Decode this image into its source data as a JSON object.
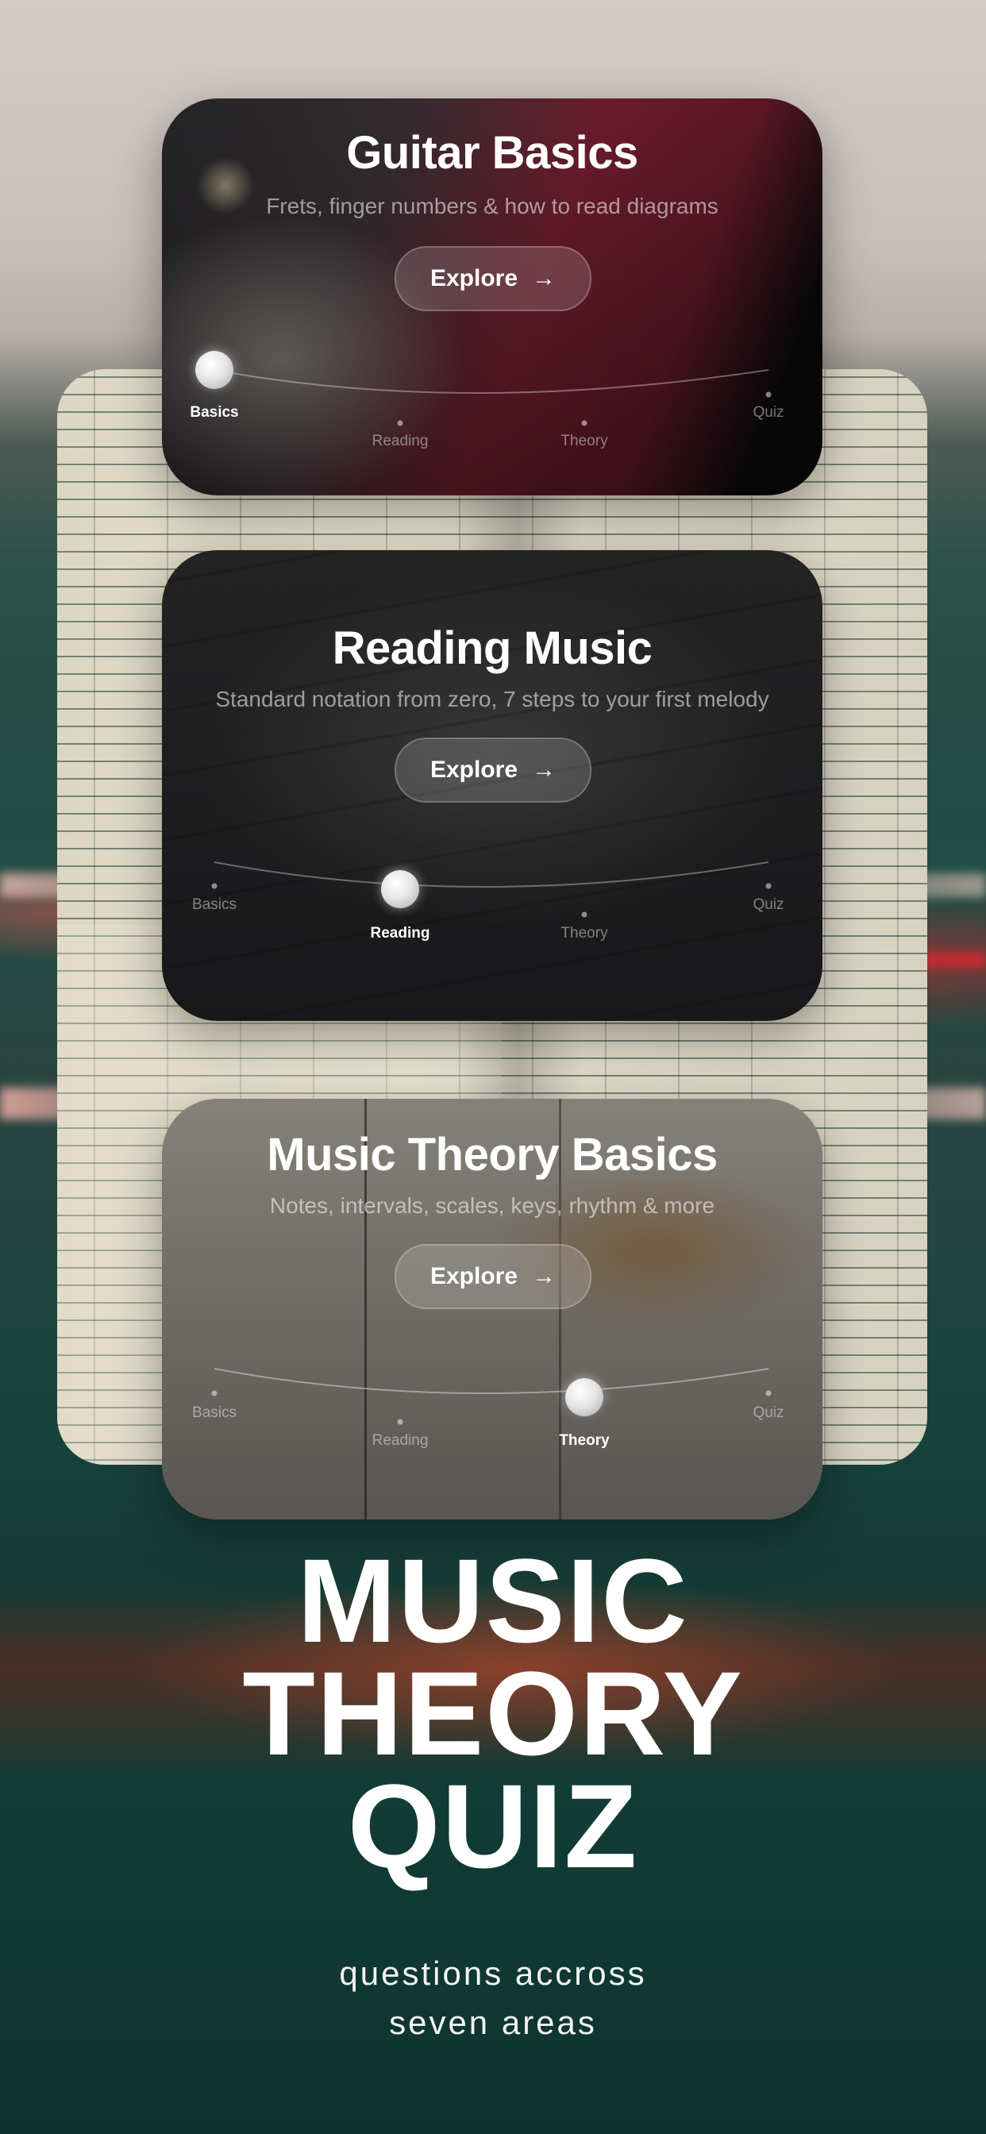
{
  "cards": [
    {
      "title": "Guitar Basics",
      "subtitle": "Frets, finger numbers & how to read diagrams",
      "button_label": "Explore",
      "stages": [
        "Basics",
        "Reading",
        "Theory",
        "Quiz"
      ],
      "active_stage": "Basics"
    },
    {
      "title": "Reading Music",
      "subtitle": "Standard notation from zero, 7 steps to your first melody",
      "button_label": "Explore",
      "stages": [
        "Basics",
        "Reading",
        "Theory",
        "Quiz"
      ],
      "active_stage": "Reading"
    },
    {
      "title": "Music Theory Basics",
      "subtitle": "Notes, intervals, scales, keys, rhythm & more",
      "button_label": "Explore",
      "stages": [
        "Basics",
        "Reading",
        "Theory",
        "Quiz"
      ],
      "active_stage": "Theory"
    }
  ],
  "headline": {
    "line1": "MUSIC",
    "line2": "THEORY",
    "line3": "QUIZ"
  },
  "tagline": {
    "line1": "questions accross",
    "line2": "seven areas"
  },
  "icons": {
    "arrow": "arrow-right-icon",
    "knob": "progress-knob-icon"
  },
  "colors": {
    "card1_tint": "#7a1f33",
    "card_dark": "#1e1e20",
    "bg_teal": "#123c36"
  }
}
